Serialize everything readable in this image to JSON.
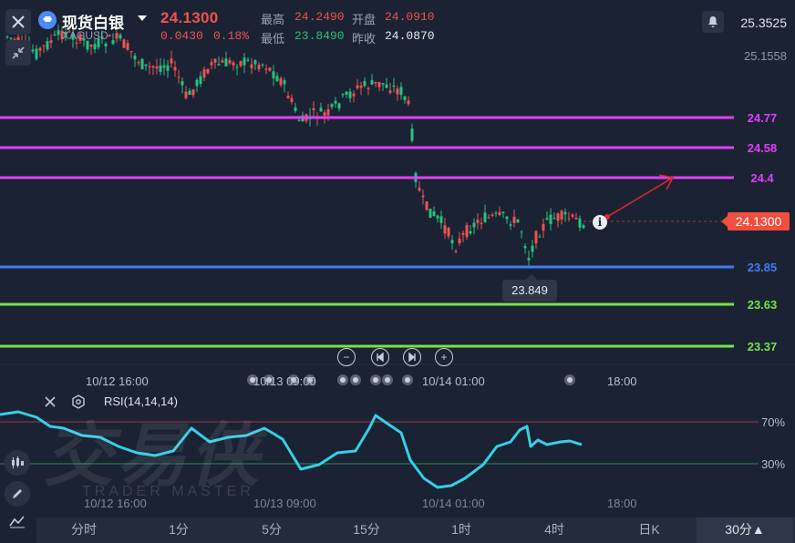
{
  "header": {
    "title": "现货白银",
    "symbol": "XAGUSD",
    "price": "24.1300",
    "change": "0.0430",
    "change_pct": "0.18%",
    "high_label": "最高",
    "high": "24.2490",
    "open_label": "开盘",
    "open": "24.0910",
    "low_label": "最低",
    "low": "23.8490",
    "prev_close_label": "昨收",
    "prev_close": "24.0870"
  },
  "price_axis": {
    "top": "25.3525",
    "second": "25.1558",
    "current": "24.1300"
  },
  "levels": [
    {
      "value": "24.77",
      "color": "#e040fb"
    },
    {
      "value": "24.58",
      "color": "#e040fb"
    },
    {
      "value": "24.4",
      "color": "#e040fb"
    },
    {
      "value": "23.85",
      "color": "#3f7cf0"
    },
    {
      "value": "23.63",
      "color": "#76e24a"
    },
    {
      "value": "23.37",
      "color": "#76e24a"
    }
  ],
  "low_tooltip": "23.849",
  "time_axis": [
    "10/12 16:00",
    "10/13 09:00",
    "10/14 01:00",
    "18:00"
  ],
  "rsi": {
    "label": "RSI(14,14,14)",
    "upper": "70%",
    "lower": "30%",
    "line_color": "#35d0e6",
    "time_axis": [
      "10/12 16:00",
      "10/13 09:00",
      "10/14 01:00",
      "18:00"
    ]
  },
  "watermark": {
    "text": "交易侠",
    "sub": "TRADER MASTER"
  },
  "tabs": [
    "分时",
    "1分",
    "5分",
    "15分",
    "1时",
    "4时",
    "日K",
    "30分▲"
  ],
  "colors": {
    "up": "#ef5350",
    "down": "#26c281",
    "background": "#1b2233"
  }
}
